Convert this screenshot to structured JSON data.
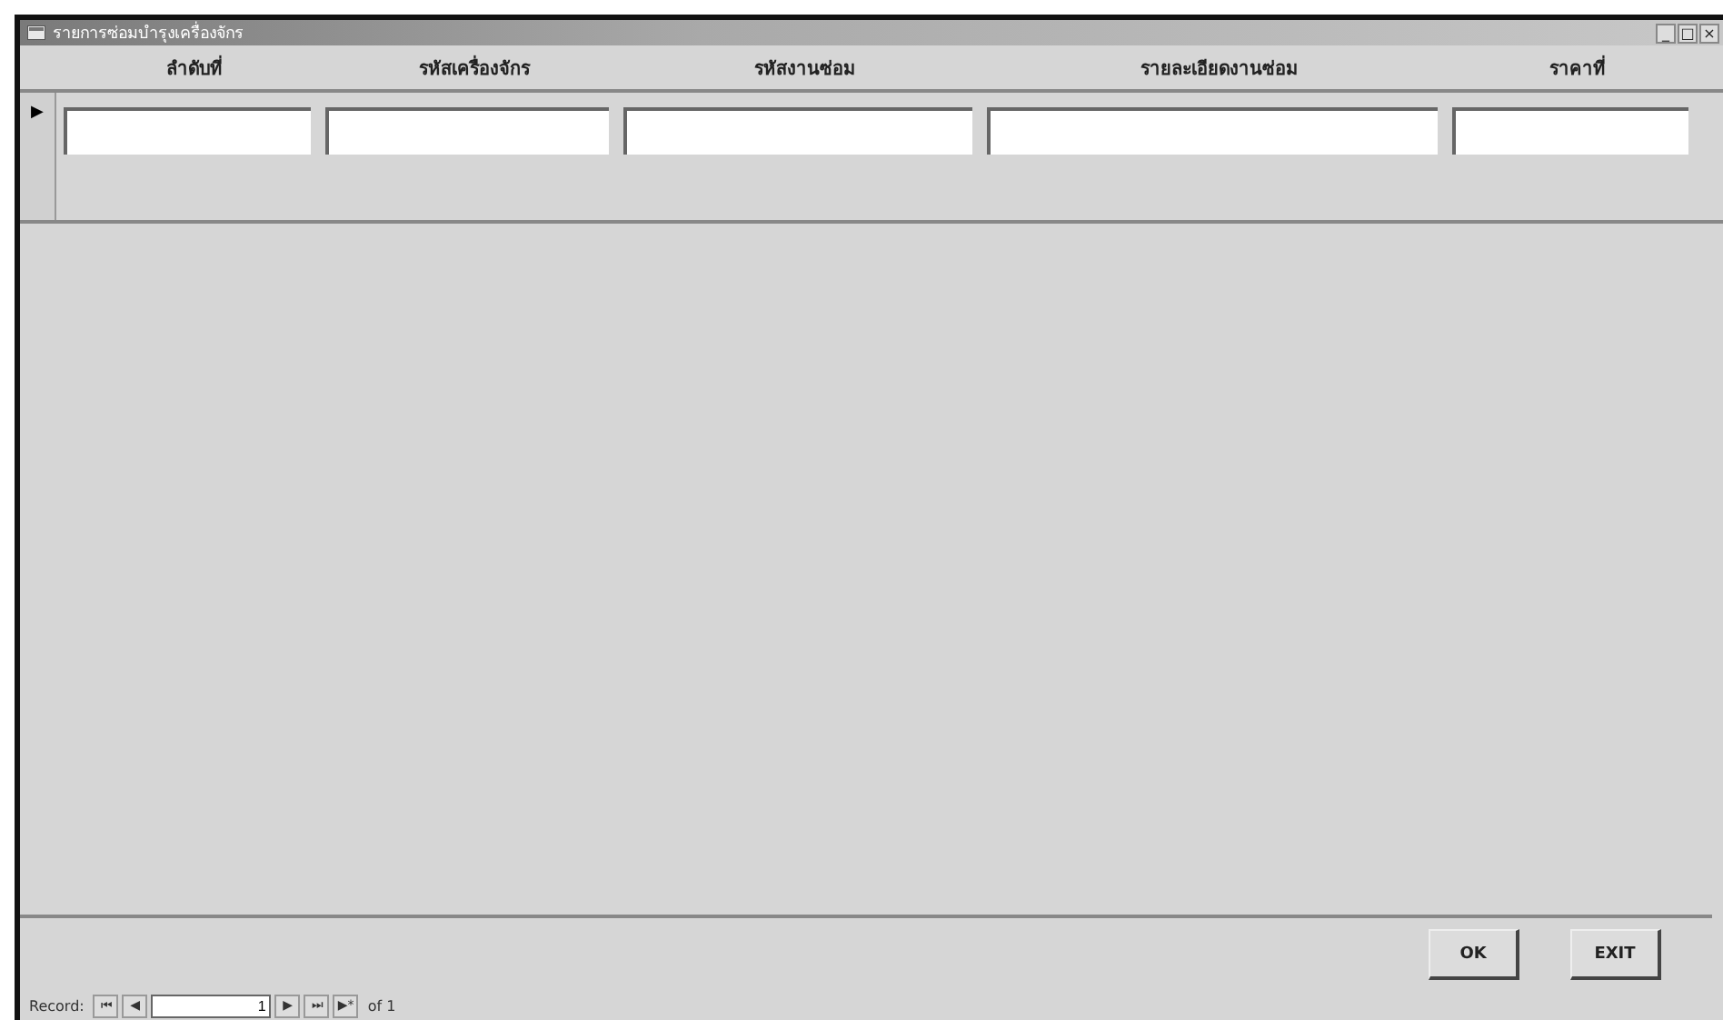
{
  "window": {
    "title": "รายการซ่อมบำรุงเครื่องจักร",
    "controls": [
      "_",
      "□",
      "×"
    ]
  },
  "columns": [
    {
      "label": "ลำดับที่"
    },
    {
      "label": "รหัสเครื่องจักร"
    },
    {
      "label": "รหัสงานซ่อม"
    },
    {
      "label": "รายละเอียดงานซ่อม"
    },
    {
      "label": "ราคาที่"
    }
  ],
  "current_record_marker": "▶",
  "buttons": [
    {
      "label": "OK"
    },
    {
      "label": "EXIT"
    }
  ],
  "navigation": {
    "label": "Record:",
    "first": "⏮",
    "prev": "◀",
    "value": "1",
    "next": "▶",
    "last": "⏭",
    "new": "▶*",
    "total": "of 1"
  }
}
